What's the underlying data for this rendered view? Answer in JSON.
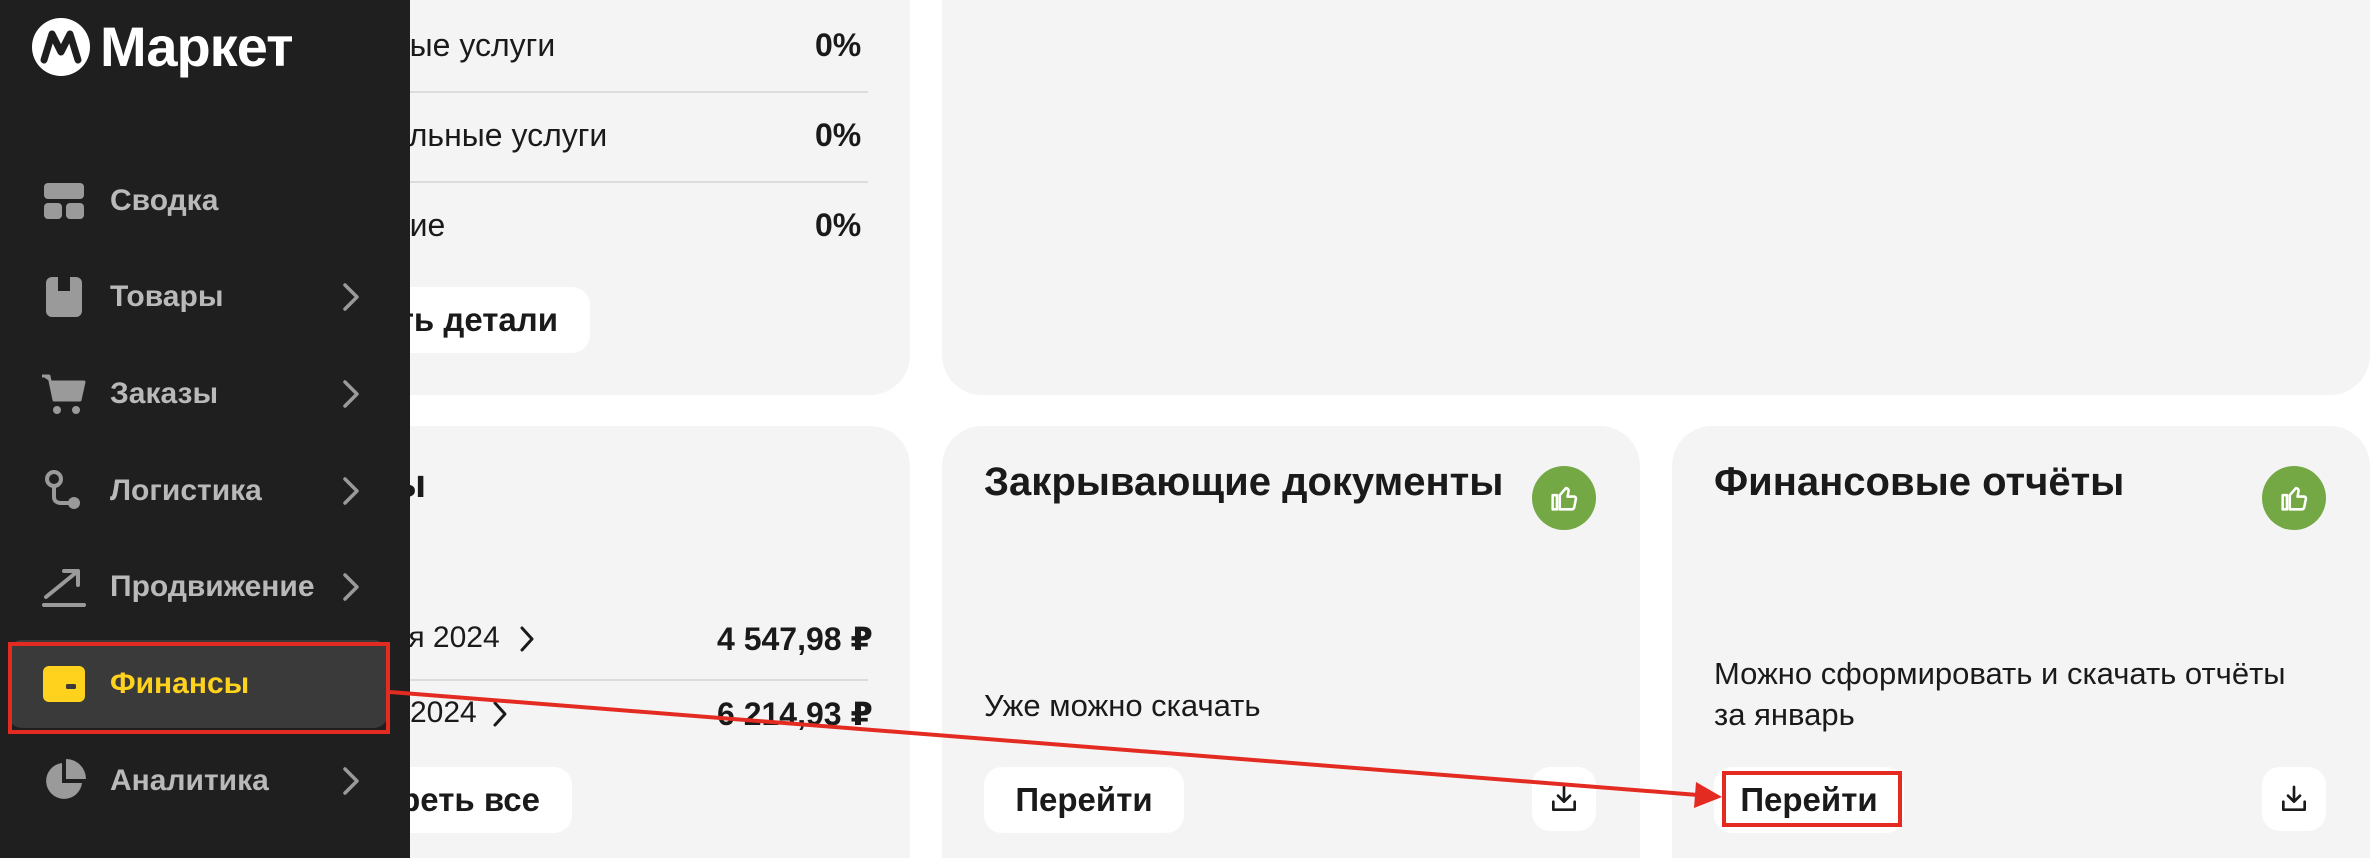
{
  "sidebar": {
    "logo_text": "Маркет",
    "items": [
      {
        "label": "Сводка",
        "icon": "dashboard-icon",
        "has_chevron": false
      },
      {
        "label": "Товары",
        "icon": "box-icon",
        "has_chevron": true
      },
      {
        "label": "Заказы",
        "icon": "cart-icon",
        "has_chevron": true
      },
      {
        "label": "Логистика",
        "icon": "route-icon",
        "has_chevron": true
      },
      {
        "label": "Продвижение",
        "icon": "trend-up-icon",
        "has_chevron": true
      },
      {
        "label": "Финансы",
        "icon": "wallet-icon",
        "has_chevron": false,
        "active": true
      },
      {
        "label": "Аналитика",
        "icon": "pie-chart-icon",
        "has_chevron": true
      }
    ]
  },
  "services_card": {
    "rows": [
      {
        "label": "ные услуги",
        "value": "0%"
      },
      {
        "label": "ельные услуги",
        "value": "0%"
      },
      {
        "label": "ние",
        "value": "0%"
      }
    ],
    "button_label": "ть детали"
  },
  "payments_card": {
    "title": "ы",
    "rows": [
      {
        "label": "ря 2024",
        "value": "4 547,98 ₽"
      },
      {
        "label": "2024",
        "value": "6 214,93 ₽"
      }
    ],
    "button_label": "реть все"
  },
  "closing_docs_card": {
    "title": "Закрывающие документы",
    "description": "Уже можно скачать",
    "button_label": "Перейти"
  },
  "financial_reports_card": {
    "title": "Финансовые отчёты",
    "description_line1": "Можно сформировать и скачать отчёты",
    "description_line2": "за январь",
    "button_label": "Перейти"
  },
  "colors": {
    "sidebar_bg": "#1f1f1f",
    "active_text": "#ffd21e",
    "like_green": "#74a845",
    "annotation_red": "#e32b22",
    "card_bg": "#f4f4f4"
  }
}
